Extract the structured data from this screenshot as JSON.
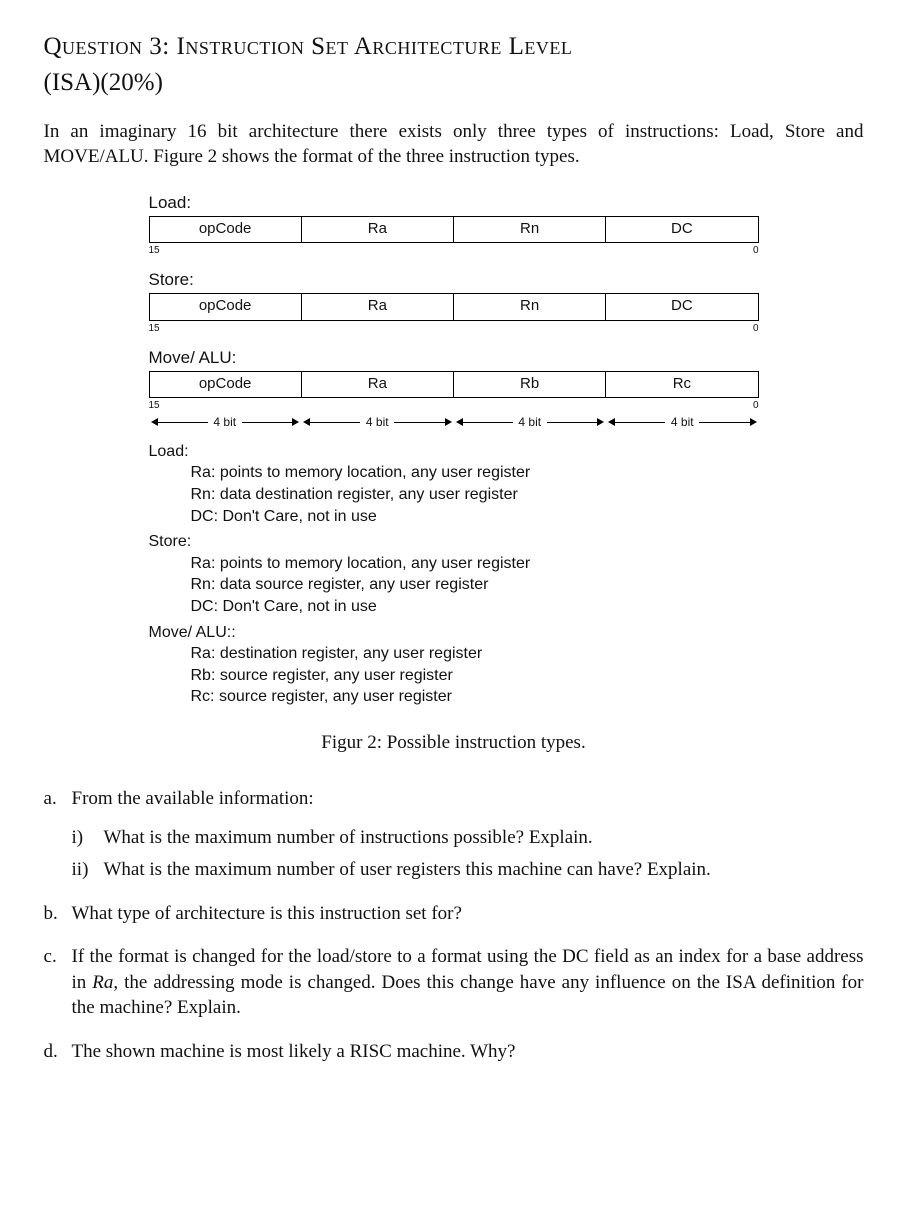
{
  "heading": {
    "title": "Question 3:  Instruction Set Architecture Level",
    "subtitle": "(ISA)(20%)"
  },
  "intro": "In an imaginary 16 bit architecture there exists only three types of instructions: Load, Store and MOVE/ALU. Figure 2 shows the format of the three instruction types.",
  "formats": [
    {
      "label": "Load:",
      "fields": [
        "opCode",
        "Ra",
        "Rn",
        "DC"
      ],
      "msb": "15",
      "lsb": "0"
    },
    {
      "label": "Store:",
      "fields": [
        "opCode",
        "Ra",
        "Rn",
        "DC"
      ],
      "msb": "15",
      "lsb": "0"
    },
    {
      "label": "Move/ ALU:",
      "fields": [
        "opCode",
        "Ra",
        "Rb",
        "Rc"
      ],
      "msb": "15",
      "lsb": "0"
    }
  ],
  "bitlabels": [
    "4 bit",
    "4 bit",
    "4 bit",
    "4 bit"
  ],
  "desc": {
    "load": {
      "head": "Load:",
      "lines": [
        "Ra: points to memory location, any user register",
        "Rn: data destination register, any user register",
        "DC: Don't Care, not in use"
      ]
    },
    "store": {
      "head": "Store:",
      "lines": [
        "Ra: points to memory location, any user register",
        "Rn: data source register, any user register",
        "DC: Don't Care, not in use"
      ]
    },
    "alu": {
      "head": "Move/ ALU::",
      "lines": [
        "Ra: destination register, any user register",
        "Rb: source register, any user register",
        "Rc: source register, any user register"
      ]
    }
  },
  "caption": "Figur 2: Possible instruction types.",
  "questions": {
    "a": {
      "stem": "From the available information:",
      "sub": [
        "What is the maximum number of instructions possible? Explain.",
        "What is the maximum number of user registers this machine can have? Explain."
      ]
    },
    "b": "What type of architecture is this instruction set for?",
    "c_pre": "If the format is changed for the load/store to a format using the DC field as an index for a base address in ",
    "c_ra": "Ra",
    "c_post": ", the addressing mode is changed. Does this change have any influence on the ISA definition for the machine? Explain.",
    "d": "The shown machine is most likely a RISC machine. Why?"
  }
}
